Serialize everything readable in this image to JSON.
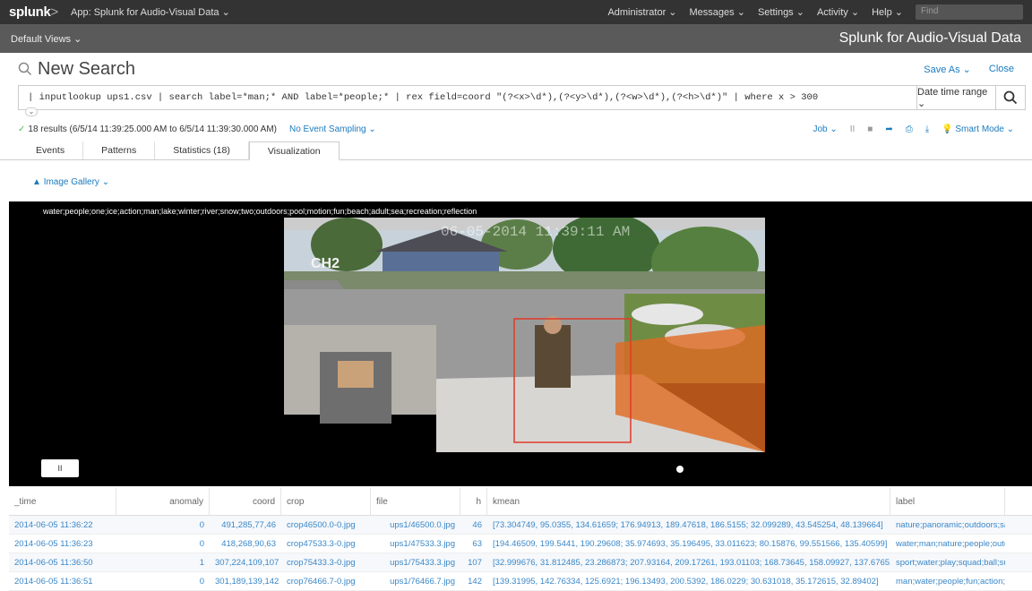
{
  "topbar": {
    "logo": "splunk",
    "logo_suffix": ">",
    "app": "App: Splunk for Audio-Visual Data ⌄",
    "nav": [
      "Administrator ⌄",
      "Messages ⌄",
      "Settings ⌄",
      "Activity ⌄",
      "Help ⌄"
    ],
    "find_placeholder": "Find"
  },
  "appbar": {
    "views": "Default Views ⌄",
    "title": "Splunk for Audio-Visual Data"
  },
  "search": {
    "title": "New Search",
    "save_as": "Save As ⌄",
    "close": "Close",
    "query": "| inputlookup ups1.csv | search label=*man;* AND label=*people;* | rex field=coord \"(?<x>\\d*),(?<y>\\d*),(?<w>\\d*),(?<h>\\d*)\" | where x > 300",
    "time_range": "Date time range ⌄"
  },
  "status": {
    "results": "18 results (6/5/14 11:39:25.000 AM to 6/5/14 11:39:30.000 AM)",
    "sampling": "No Event Sampling ⌄",
    "job": "Job ⌄",
    "mode": "Smart Mode ⌄"
  },
  "tabs": [
    "Events",
    "Patterns",
    "Statistics (18)",
    "Visualization"
  ],
  "gallery": "Image Gallery ⌄",
  "viewer": {
    "tags": "water;people;one;ice;action;man;lake;winter;river;snow;two;outdoors;pool;motion;fun;beach;adult;sea;recreation;reflection",
    "overlay_date": "06-05-2014  11:39:11 AM",
    "channel": "CH2",
    "pause": "II"
  },
  "table": {
    "headers": [
      "_time",
      "anomaly",
      "coord",
      "crop",
      "file",
      "h",
      "kmean",
      "label"
    ],
    "rows": [
      [
        "2014-06-05 11:36:22",
        "0",
        "491,285,77,46",
        "crop46500.0-0.jpg",
        "ups1/46500.0.jpg",
        "46",
        "[73.304749, 95.0355, 134.61659; 176.94913, 189.47618, 186.5155; 32.099289, 43.545254, 48.139664]",
        "nature;panoramic;outdoors;sa"
      ],
      [
        "2014-06-05 11:36:23",
        "0",
        "418,268,90,63",
        "crop47533.3-0.jpg",
        "ups1/47533.3.jpg",
        "63",
        "[194.46509, 199.5441, 190.29608; 35.974693, 35.196495, 33.011623; 80.15876, 99.551566, 135.40599]",
        "water;man;nature;people;outd"
      ],
      [
        "2014-06-05 11:36:50",
        "1",
        "307,224,109,107",
        "crop75433.3-0.jpg",
        "ups1/75433.3.jpg",
        "107",
        "[32.999676, 31.812485, 23.286873; 207.93164, 209.17261, 193.01103; 168.73645, 158.09927, 137.67651]",
        "sport;water;play;squad;ball;su"
      ],
      [
        "2014-06-05 11:36:51",
        "0",
        "301,189,139,142",
        "crop76466.7-0.jpg",
        "ups1/76466.7.jpg",
        "142",
        "[139.31995, 142.76334, 125.6921; 196.13493, 200.5392, 186.0229; 30.631018, 35.172615, 32.89402]",
        "man;water;people;fun;action;o"
      ]
    ]
  }
}
